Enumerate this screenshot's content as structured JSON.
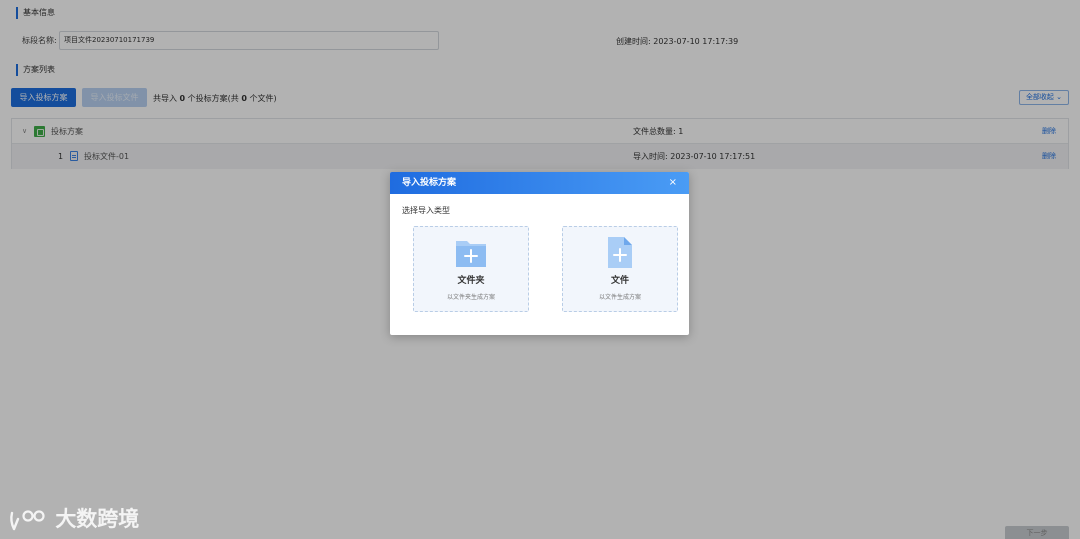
{
  "basic_info": {
    "section_title": "基本信息",
    "name_label": "标段名称:",
    "name_value": "项目文件20230710171739",
    "created_label": "创建时间:",
    "created_value": "2023-07-10 17:17:39"
  },
  "plan_list": {
    "section_title": "方案列表",
    "import_button": "导入投标方案",
    "import_file_button": "导入投标文件",
    "summary_prefix": "共导入",
    "summary_count": "0",
    "summary_mid": "个投标方案(共",
    "summary_file_count": "0",
    "summary_suffix": "个文件)",
    "collapse_all": "全部收起",
    "tree": {
      "group": {
        "name": "投标方案",
        "file_count_label": "文件总数量:",
        "file_count": "1",
        "delete": "删除"
      },
      "item": {
        "index": "1",
        "name": "投标文件-01",
        "import_time_label": "导入时间:",
        "import_time": "2023-07-10 17:17:51",
        "delete": "删除"
      }
    }
  },
  "footer": {
    "next_button": "下一步"
  },
  "watermark": {
    "text": "大数跨境"
  },
  "modal": {
    "title": "导入投标方案",
    "close": "×",
    "subtitle": "选择导入类型",
    "options": [
      {
        "title": "文件夹",
        "desc": "以文件夹生成方案",
        "icon": "folder-plus-icon"
      },
      {
        "title": "文件",
        "desc": "以文件生成方案",
        "icon": "file-plus-icon"
      }
    ]
  },
  "colors": {
    "primary": "#1e6fe0",
    "header_gradient_end": "#4a9cf5",
    "green_icon": "#3fae49",
    "card_bg": "#f2f6fc"
  }
}
